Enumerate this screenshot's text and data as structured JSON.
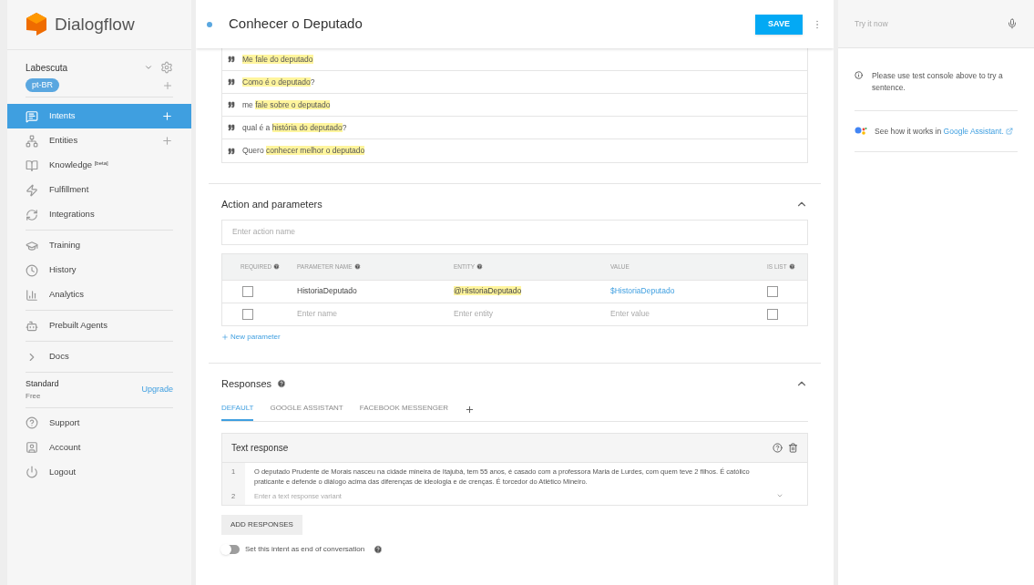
{
  "brand": "Dialogflow",
  "sidebar": {
    "agent": "Labescuta",
    "language": "pt-BR",
    "nav_groups": [
      [
        {
          "label": "Intents",
          "selected": true,
          "has_add": true
        },
        {
          "label": "Entities",
          "selected": false,
          "has_add": true
        },
        {
          "label": "Knowledge $^{[beta]}$",
          "selected": false,
          "has_add": false
        },
        {
          "label": "Fulfillment",
          "selected": false,
          "has_add": false
        },
        {
          "label": "Integrations",
          "selected": false,
          "has_add": false
        }
      ],
      [
        {
          "label": "Training",
          "selected": false,
          "has_add": false
        },
        {
          "label": "History",
          "selected": false,
          "has_add": false
        },
        {
          "label": "Analytics",
          "selected": false,
          "has_add": false
        }
      ],
      [
        {
          "label": "Prebuilt Agents",
          "selected": false,
          "has_add": false
        }
      ],
      [
        {
          "label": "Docs",
          "selected": false,
          "has_add": false
        }
      ]
    ],
    "plan": {
      "name": "Standard",
      "tier": "Free",
      "upgrade": "Upgrade"
    },
    "footer_items": [
      {
        "label": "Support"
      },
      {
        "label": "Account"
      },
      {
        "label": "Logout"
      }
    ]
  },
  "header": {
    "title": "Conhecer o Deputado",
    "save": "SAVE"
  },
  "training_phrases": [
    [
      {
        "text": "Me fale do deputado",
        "annotated": true
      }
    ],
    [
      {
        "text": "Como é o deputado",
        "annotated": true
      },
      {
        "text": "?",
        "annotated": false
      }
    ],
    [
      {
        "text": "me ",
        "annotated": false
      },
      {
        "text": "fale sobre o deputado",
        "annotated": true
      }
    ],
    [
      {
        "text": "qual é a ",
        "annotated": false
      },
      {
        "text": "história do deputado",
        "annotated": true
      },
      {
        "text": "?",
        "annotated": false
      }
    ],
    [
      {
        "text": "Quero ",
        "annotated": false
      },
      {
        "text": "conhecer melhor o deputado",
        "annotated": true
      }
    ]
  ],
  "action": {
    "title": "Action and parameters",
    "placeholder": "Enter action name",
    "columns": [
      {
        "label": "REQUIRED",
        "has_help": true
      },
      {
        "label": "PARAMETER NAME",
        "has_help": true
      },
      {
        "label": "ENTITY",
        "has_help": true
      },
      {
        "label": "VALUE",
        "has_help": false
      },
      {
        "label": "IS LIST",
        "has_help": true
      }
    ],
    "rows": [
      {
        "required": false,
        "name": "HistoriaDeputado",
        "entity": "@HistoriaDeputado",
        "value": "$HistoriaDeputado",
        "is_list": false
      }
    ],
    "new_row": {
      "required": false,
      "name_placeholder": "Enter name",
      "entity_placeholder": "Enter entity",
      "value_placeholder": "Enter value",
      "is_list": false
    },
    "new_parameter": "New parameter"
  },
  "responses": {
    "title": "Responses",
    "tabs": [
      {
        "label": "DEFAULT",
        "selected": true
      },
      {
        "label": "GOOGLE ASSISTANT",
        "selected": false
      },
      {
        "label": "FACEBOOK MESSENGER",
        "selected": false
      }
    ],
    "card_title": "Text response",
    "lines": [
      {
        "number": "1",
        "text": "O deputado Prudente de Morais nasceu na cidade mineira de Itajubá, tem 55 anos, é casado com a professora Maria de Lurdes, com quem teve 2 filhos. É católico praticante e defende o diálogo acima das diferenças de ideologia e de crenças. É torcedor do Atlético Mineiro."
      },
      {
        "number": "2",
        "placeholder": "Enter a text response variant"
      }
    ],
    "add": "ADD RESPONSES",
    "end_conversation": {
      "label": "Set this intent as end of conversation",
      "on": false
    }
  },
  "console": {
    "placeholder": "Try it now",
    "info": "Please use test console above to try a sentence.",
    "assistant_text": "See how it works in ",
    "assistant_link": "Google Assistant."
  }
}
